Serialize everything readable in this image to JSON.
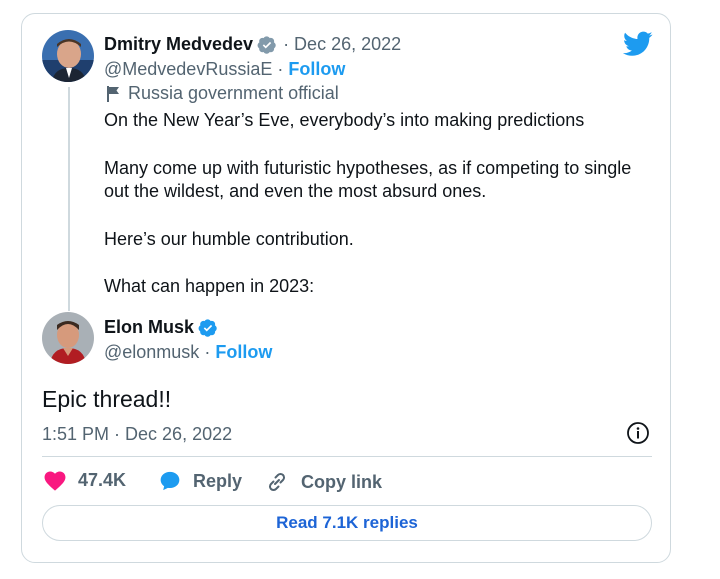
{
  "quoted_tweet": {
    "author_name": "Dmitry Medvedev",
    "date": "· Dec 26, 2022",
    "handle": "@MedvedevRussiaE",
    "separator": "·",
    "follow_label": "Follow",
    "label": "Russia government official",
    "lines": [
      "On the New Year’s Eve, everybody’s into making predictions",
      "Many come up with futuristic hypotheses, as if competing to single",
      "out the wildest, and even the most absurd ones.",
      "Here’s our humble contribution.",
      "What can happen in 2023:"
    ]
  },
  "tweet": {
    "author_name": "Elon Musk",
    "handle": "@elonmusk",
    "separator": "·",
    "follow_label": "Follow",
    "text": "Epic thread!!",
    "timestamp": "1:51 PM · Dec 26, 2022"
  },
  "actions": {
    "likes": "47.4K",
    "reply_label": "Reply",
    "copy_link_label": "Copy link"
  },
  "read_replies_label": "Read 7.1K replies",
  "colors": {
    "brand_blue": "#1d9bf0",
    "like_pink": "#f91880",
    "text_gray": "#536471",
    "border": "#cfd9de"
  },
  "icons": [
    "twitter-bird-icon",
    "verified-badge-icon",
    "flag-icon",
    "info-icon",
    "heart-icon",
    "reply-bubble-icon",
    "link-icon"
  ]
}
